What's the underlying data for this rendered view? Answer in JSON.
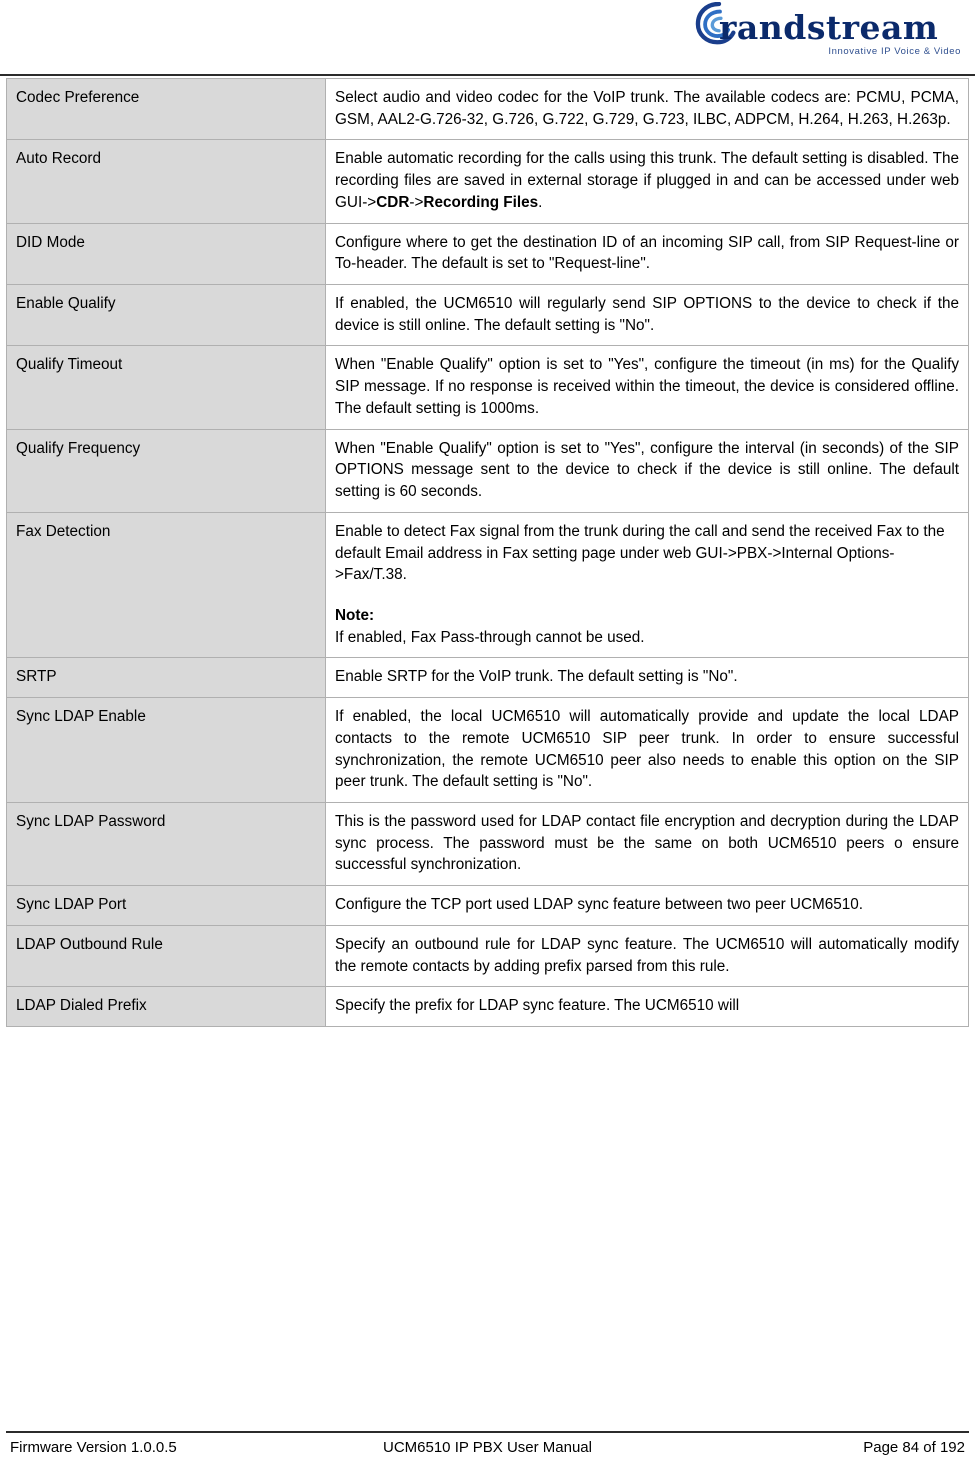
{
  "header": {
    "brand": "randstream",
    "brand_initial": "G",
    "tagline": "Innovative IP Voice & Video"
  },
  "table": {
    "rows": [
      {
        "label": "Codec Preference",
        "desc": "Select audio and video codec for the VoIP trunk. The available codecs are: PCMU, PCMA, GSM, AAL2-G.726-32, G.726, G.722, G.729, G.723, ILBC, ADPCM, H.264, H.263, H.263p."
      },
      {
        "label": "Auto Record",
        "desc_parts": [
          "Enable automatic recording for the calls using this trunk. The default setting is disabled. The recording files are saved in external storage if plugged in and can be accessed under web GUI->",
          "CDR",
          "->",
          "Recording Files",
          "."
        ]
      },
      {
        "label": "DID Mode",
        "desc": "Configure where to get the destination ID of an incoming SIP call, from SIP Request-line or To-header. The default is set to \"Request-line\"."
      },
      {
        "label": "Enable Qualify",
        "desc": "If enabled, the UCM6510 will regularly send SIP OPTIONS to the device to check if the device is still online. The default setting is \"No\"."
      },
      {
        "label": "Qualify Timeout",
        "desc": "When \"Enable Qualify\" option is set to \"Yes\", configure the timeout (in ms) for the Qualify SIP message. If no response is received within the timeout, the device is considered offline. The default setting is 1000ms."
      },
      {
        "label": "Qualify Frequency",
        "desc": "When \"Enable Qualify\" option is set to \"Yes\", configure the interval (in seconds) of the SIP OPTIONS message sent to the device to check if the device is still online. The default setting is 60 seconds."
      },
      {
        "label": "Fax Detection",
        "desc_line1": "Enable to detect Fax signal from the trunk during the call and send the received Fax to the default Email address in Fax setting page under web GUI->PBX->Internal Options->Fax/T.38.",
        "note_label": "Note:",
        "desc_line2": "If enabled, Fax Pass-through cannot be used."
      },
      {
        "label": "SRTP",
        "desc": "Enable SRTP for the VoIP trunk. The default setting is \"No\"."
      },
      {
        "label": "Sync LDAP Enable",
        "desc": "If enabled, the local UCM6510 will automatically provide and update the local LDAP contacts to the remote UCM6510 SIP peer trunk. In order to ensure successful synchronization, the remote UCM6510 peer also needs to enable this option on the SIP peer trunk. The default setting is \"No\"."
      },
      {
        "label": "Sync LDAP Password",
        "desc": "This is the password used for LDAP contact file encryption and decryption during the LDAP sync process. The password must be the same on both UCM6510 peers o ensure successful synchronization."
      },
      {
        "label": "Sync LDAP Port",
        "desc": "Configure the TCP port used LDAP sync feature between two peer UCM6510."
      },
      {
        "label": "LDAP Outbound Rule",
        "desc": "Specify an outbound rule for LDAP sync feature. The UCM6510 will automatically modify the remote contacts by adding prefix parsed from this rule."
      },
      {
        "label": "LDAP Dialed Prefix",
        "desc": "Specify the prefix for LDAP sync feature. The UCM6510 will"
      }
    ]
  },
  "footer": {
    "left": "Firmware Version 1.0.0.5",
    "center": "UCM6510 IP PBX User Manual",
    "right": "Page 84 of 192"
  }
}
